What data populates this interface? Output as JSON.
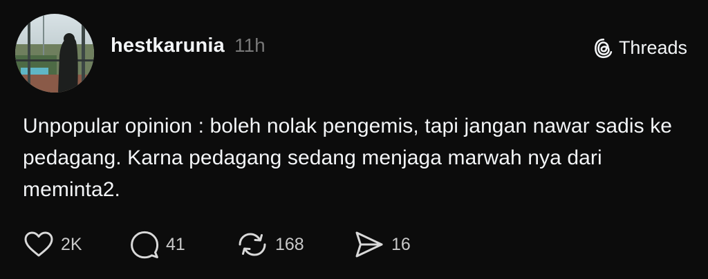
{
  "post": {
    "author": {
      "username": "hestkarunia",
      "timestamp": "11h"
    },
    "brand": {
      "label": "Threads",
      "icon": "threads-logo-icon"
    },
    "text": "Unpopular opinion : boleh nolak pengemis, tapi jangan nawar sadis ke pedagang. Karna pedagang sedang menjaga marwah nya dari meminta2.",
    "actions": {
      "like": {
        "icon": "heart-icon",
        "count": "2K"
      },
      "reply": {
        "icon": "comment-icon",
        "count": "41"
      },
      "repost": {
        "icon": "repost-icon",
        "count": "168"
      },
      "share": {
        "icon": "send-icon",
        "count": "16"
      }
    }
  },
  "colors": {
    "background": "#0c0c0c",
    "text_primary": "#f3f5f7",
    "text_secondary": "#777777"
  }
}
